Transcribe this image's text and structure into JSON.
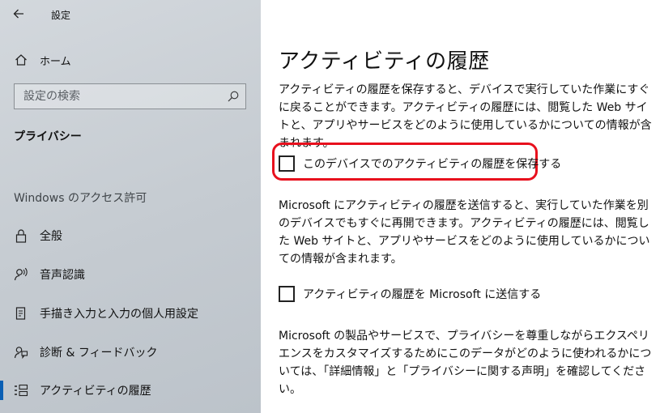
{
  "window": {
    "title": "設定"
  },
  "sidebar": {
    "home_label": "ホーム",
    "search_placeholder": "設定の検索",
    "section_title": "プライバシー",
    "group_title": "Windows のアクセス許可",
    "items": [
      {
        "label": "全般",
        "icon": "lock-icon"
      },
      {
        "label": "音声認識",
        "icon": "speech-icon"
      },
      {
        "label": "手描き入力と入力の個人用設定",
        "icon": "inking-icon"
      },
      {
        "label": "診断 & フィードバック",
        "icon": "feedback-icon"
      },
      {
        "label": "アクティビティの履歴",
        "icon": "activity-history-icon",
        "selected": true
      }
    ]
  },
  "main": {
    "title": "アクティビティの履歴",
    "description1": "アクティビティの履歴を保存すると、デバイスで実行していた作業にすぐに戻ることができます。アクティビティの履歴には、閲覧した Web サイトと、アプリやサービスをどのように使用しているかについての情報が含まれます。",
    "checkbox1_label": "このデバイスでのアクティビティの履歴を保存する",
    "checkbox1_checked": false,
    "description2": "Microsoft にアクティビティの履歴を送信すると、実行していた作業を別のデバイスでもすぐに再開できます。アクティビティの履歴には、閲覧した Web サイトと、アプリやサービスをどのように使用しているかについての情報が含まれます。",
    "checkbox2_label": "アクティビティの履歴を Microsoft に送信する",
    "checkbox2_checked": false,
    "description3": "Microsoft の製品やサービスで、プライバシーを尊重しながらエクスペリエンスをカスタマイズするためにこのデータがどのように使われるかについては、「詳細情報」と「プライバシーに関する声明」を確認してください。"
  },
  "colors": {
    "accent": "#0a5fb4",
    "highlight": "#e8101d",
    "sidebar_bg": "#c8ced4"
  }
}
